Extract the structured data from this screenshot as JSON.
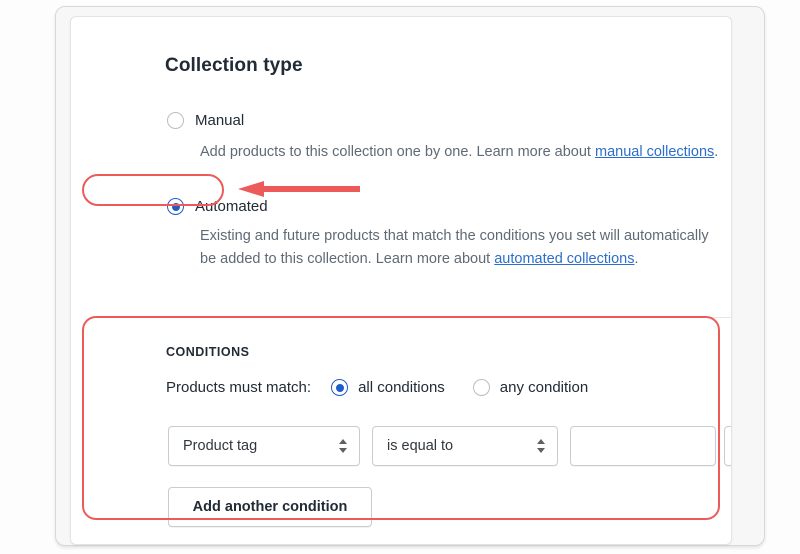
{
  "page": {
    "section_title": "Collection type"
  },
  "collection_type": {
    "options": [
      {
        "id": "manual",
        "label": "Manual",
        "selected": false,
        "help_prefix": "Add products to this collection one by one. Learn more about ",
        "help_link": "manual collections",
        "help_suffix": "."
      },
      {
        "id": "automated",
        "label": "Automated",
        "selected": true,
        "help_prefix": "Existing and future products that match the conditions you set will automatically be added to this collection. Learn more about ",
        "help_link": "automated collections",
        "help_suffix": "."
      }
    ]
  },
  "conditions": {
    "heading": "CONDITIONS",
    "match_label": "Products must match:",
    "match_options": [
      {
        "id": "all",
        "label": "all conditions",
        "selected": true
      },
      {
        "id": "any",
        "label": "any condition",
        "selected": false
      }
    ],
    "rule": {
      "field_value": "Product tag",
      "operator_value": "is equal to",
      "value_text": "",
      "value_placeholder": "",
      "unit_value": ""
    },
    "add_button_label": "Add another condition"
  },
  "annotations": {
    "highlight_color": "#ec5a5a",
    "arrow_target": "automated-radio",
    "boxes": [
      "automated-option",
      "conditions-section"
    ]
  },
  "colors": {
    "accent_blue": "#1f5dc9",
    "link_blue": "#2c6ecb",
    "text_dark": "#212b36",
    "text_muted": "#5f6a75",
    "annotation_red": "#ec5a5a"
  }
}
